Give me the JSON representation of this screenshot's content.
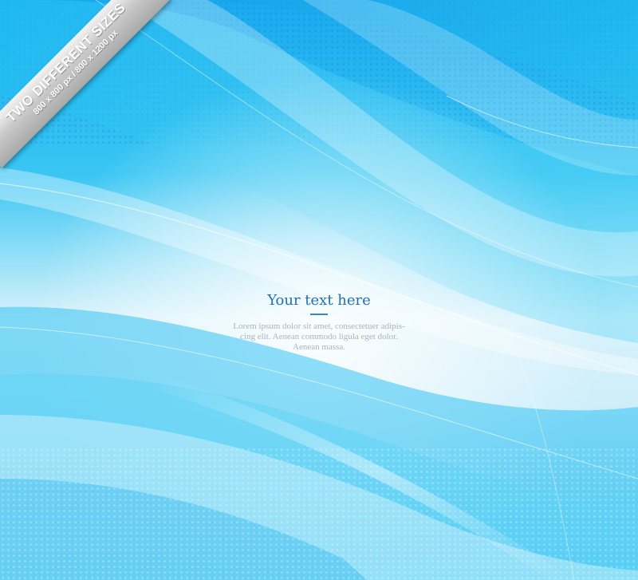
{
  "badge": {
    "line1": "TWO DIFFERENT SIZES",
    "line2": "800 x 800 px / 800 x 1200 px"
  },
  "content": {
    "title": "Your text here",
    "body_line1": "Lorem ipsum dolor sit amet, consectetuer adipis-",
    "body_line2": "cing elit. Aenean commodo ligula eget dolor.",
    "body_line3": "Aenean massa."
  },
  "colors": {
    "title": "#1f6fb8",
    "body": "#a8b4bd",
    "primary_blue": "#1aa9ee"
  }
}
